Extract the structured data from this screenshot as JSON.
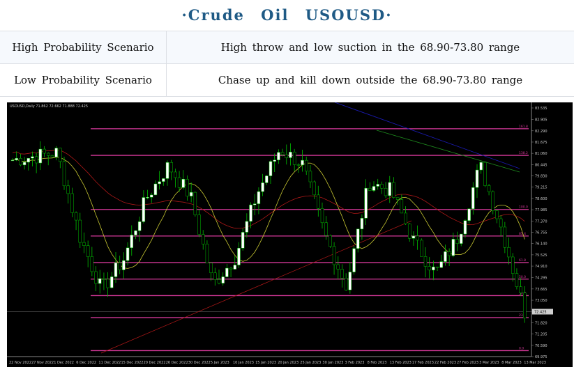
{
  "header": {
    "title": "·Crude Oil USOUSD·"
  },
  "scenarios": [
    {
      "label": "High Probability Scenario",
      "text": "High throw and low suction in the 68.90-73.80 range"
    },
    {
      "label": "Low Probability Scenario",
      "text": "Chase up and kill down outside the 68.90-73.80 range"
    }
  ],
  "chart": {
    "ticker": "USOUSD,Daily  71.862 72.662 71.888 72.425",
    "price_labels": [
      "83.535",
      "82.905",
      "82.290",
      "81.675",
      "81.060",
      "80.445",
      "79.830",
      "79.215",
      "78.600",
      "77.985",
      "77.370",
      "76.755",
      "76.140",
      "75.525",
      "74.910",
      "74.295",
      "73.665",
      "73.050",
      "72.425",
      "71.820",
      "71.205",
      "70.590",
      "69.975"
    ],
    "current_price": "72.425",
    "date_labels": [
      "22 Nov 2022",
      "27 Nov 2022",
      "1 Dec 2022",
      "6 Dec 2022",
      "11 Dec 2022",
      "15 Dec 2022",
      "20 Dec 2022",
      "26 Dec 2022",
      "30 Dec 2022",
      "5 Jan 2023",
      "10 Jan 2023",
      "15 Jan 2023",
      "20 Jan 2023",
      "25 Jan 2023",
      "30 Jan 2023",
      "3 Feb 2023",
      "8 Feb 2023",
      "13 Feb 2023",
      "17 Feb 2023",
      "22 Feb 2023",
      "27 Feb 2023",
      "3 Mar 2023",
      "8 Mar 2023",
      "13 Mar 2023"
    ],
    "level_lines": [
      82.4,
      80.95,
      78.0,
      76.55,
      75.1,
      74.2,
      73.3,
      72.1,
      70.3
    ],
    "level_tags": [
      "161.8",
      "138.2",
      "100.0",
      "85.4",
      "61.8",
      "50.0",
      "38.2",
      "23.6",
      "0.0"
    ],
    "colors": {
      "background": "#000000",
      "bull": "#ffffff",
      "bear": "#000000",
      "wick": "#00c000",
      "level": "#d6389a",
      "ma_yellow": "#c8c832",
      "ma_red": "#b01818",
      "ma_green": "#1e8c1e",
      "ma_blue": "#1a1ab0"
    }
  },
  "chart_data": {
    "type": "candlestick",
    "title": "USOUSD,Daily",
    "x": [
      "22 Nov 2022",
      "27 Nov 2022",
      "1 Dec 2022",
      "6 Dec 2022",
      "11 Dec 2022",
      "15 Dec 2022",
      "20 Dec 2022",
      "26 Dec 2022",
      "30 Dec 2022",
      "5 Jan 2023",
      "10 Jan 2023",
      "15 Jan 2023",
      "20 Jan 2023",
      "25 Jan 2023",
      "30 Jan 2023",
      "3 Feb 2023",
      "8 Feb 2023",
      "13 Feb 2023",
      "17 Feb 2023",
      "22 Feb 2023",
      "27 Feb 2023",
      "3 Mar 2023",
      "8 Mar 2023",
      "13 Mar 2023"
    ],
    "close": [
      80.7,
      80.9,
      81.1,
      76.6,
      73.6,
      75.3,
      78.6,
      80.4,
      78.7,
      73.9,
      75.4,
      78.9,
      81.3,
      80.5,
      76.7,
      73.8,
      79.5,
      79.0,
      76.3,
      74.5,
      76.5,
      80.4,
      76.8,
      72.4
    ],
    "ylim": [
      69.975,
      83.535
    ],
    "horizontal_levels": [
      82.4,
      80.95,
      78.0,
      76.55,
      75.1,
      74.2,
      73.3,
      72.1,
      70.3
    ],
    "ylabel": "",
    "xlabel": ""
  }
}
